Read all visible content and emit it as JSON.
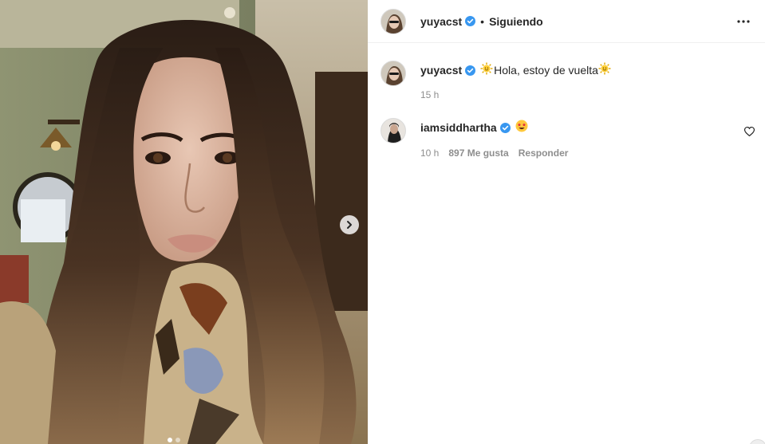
{
  "post": {
    "author": "yuyacst",
    "follow_state": "Siguiendo",
    "separator": "•",
    "slide_index": 1,
    "slide_count": 2
  },
  "caption": {
    "username": "yuyacst",
    "text": "Hola, estoy de vuelta",
    "time": "15 h"
  },
  "comments": [
    {
      "username": "iamsiddhartha",
      "emoji": "star-struck",
      "time": "10 h",
      "likes": "897 Me gusta",
      "reply": "Responder"
    }
  ],
  "colors": {
    "verified": "#3897f0",
    "muted": "#8e8e8e",
    "text": "#262626"
  }
}
